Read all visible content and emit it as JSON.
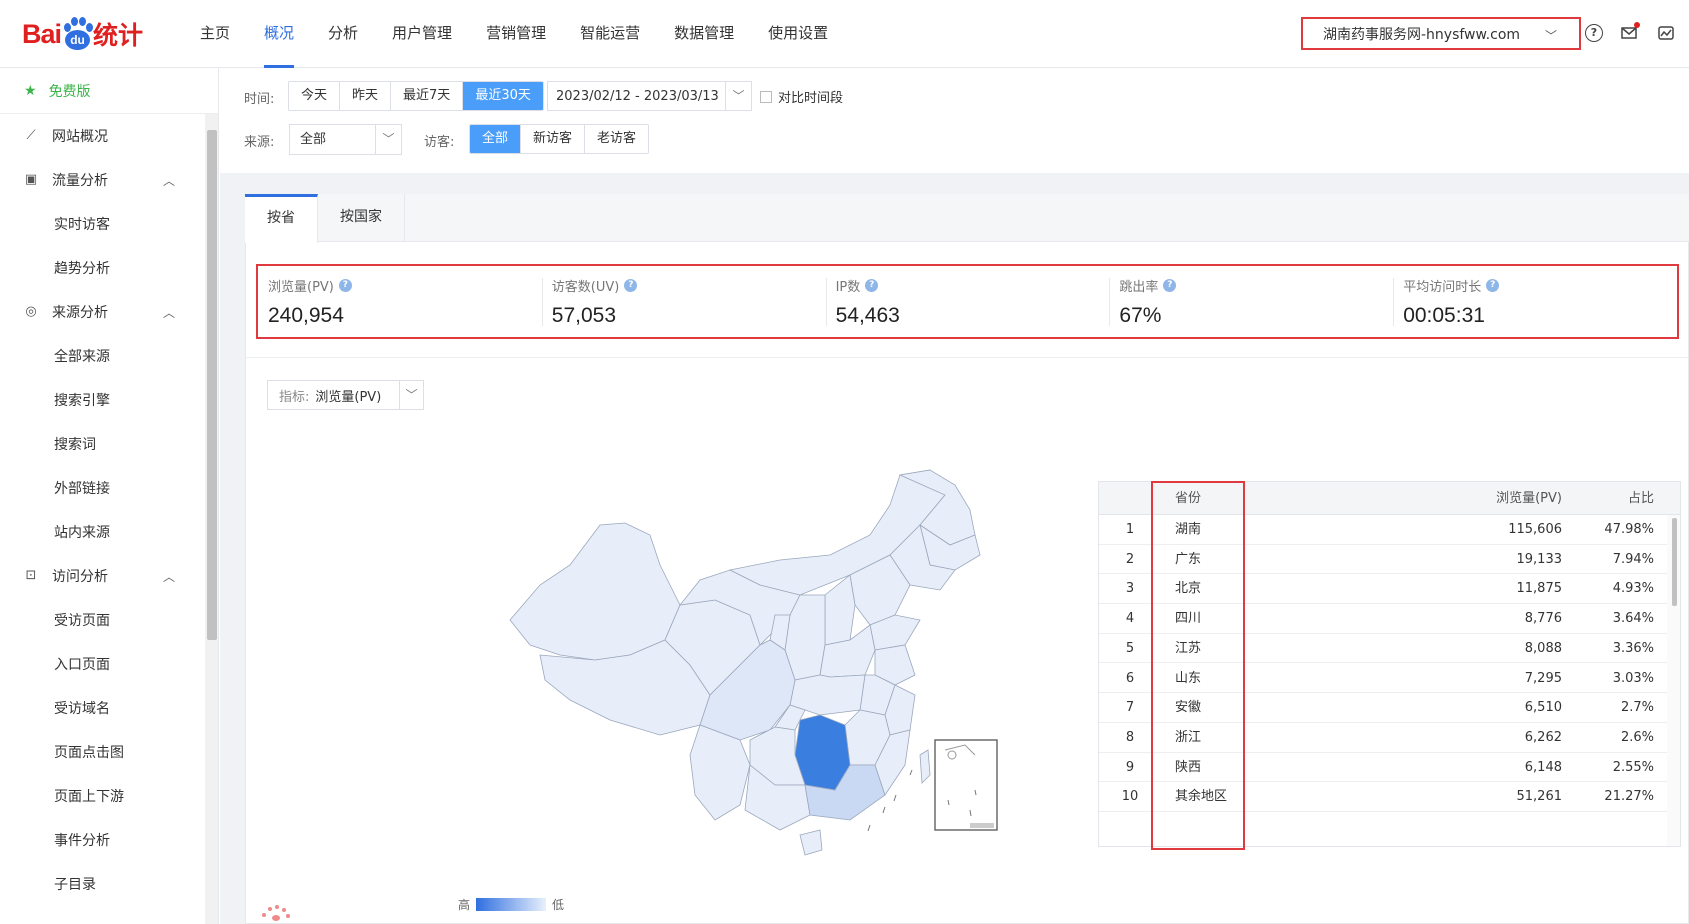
{
  "logo": {
    "bai": "Bai",
    "du": "du",
    "stat": "统计"
  },
  "nav": [
    "主页",
    "概况",
    "分析",
    "用户管理",
    "营销管理",
    "智能运营",
    "数据管理",
    "使用设置"
  ],
  "nav_active_index": 1,
  "site_selector": "湖南药事服务网-hnysfww.com",
  "top_icons": [
    "help-icon",
    "mail-icon",
    "chart-icon"
  ],
  "sidebar": {
    "edition": "免费版",
    "items": [
      {
        "label": "网站概况",
        "type": "parent",
        "icon": "line-chart-icon"
      },
      {
        "label": "流量分析",
        "type": "parent",
        "icon": "traffic-icon",
        "expanded": true
      },
      {
        "label": "实时访客",
        "type": "child"
      },
      {
        "label": "趋势分析",
        "type": "child"
      },
      {
        "label": "来源分析",
        "type": "parent",
        "icon": "signal-icon",
        "expanded": true
      },
      {
        "label": "全部来源",
        "type": "child"
      },
      {
        "label": "搜索引擎",
        "type": "child"
      },
      {
        "label": "搜索词",
        "type": "child"
      },
      {
        "label": "外部链接",
        "type": "child"
      },
      {
        "label": "站内来源",
        "type": "child"
      },
      {
        "label": "访问分析",
        "type": "parent",
        "icon": "visit-icon",
        "expanded": true
      },
      {
        "label": "受访页面",
        "type": "child"
      },
      {
        "label": "入口页面",
        "type": "child"
      },
      {
        "label": "受访域名",
        "type": "child"
      },
      {
        "label": "页面点击图",
        "type": "child"
      },
      {
        "label": "页面上下游",
        "type": "child"
      },
      {
        "label": "事件分析",
        "type": "child"
      },
      {
        "label": "子目录",
        "type": "child"
      }
    ]
  },
  "filters": {
    "time_label": "时间:",
    "time_options": [
      "今天",
      "昨天",
      "最近7天",
      "最近30天"
    ],
    "time_active": 3,
    "date_range": "2023/02/12 - 2023/03/13",
    "compare_label": "对比时间段",
    "source_label": "来源:",
    "source_value": "全部",
    "visitor_label": "访客:",
    "visitor_options": [
      "全部",
      "新访客",
      "老访客"
    ],
    "visitor_active": 0
  },
  "tabs": [
    "按省",
    "按国家"
  ],
  "tab_active": 0,
  "metrics": [
    {
      "label": "浏览量(PV)",
      "value": "240,954"
    },
    {
      "label": "访客数(UV)",
      "value": "57,053"
    },
    {
      "label": "IP数",
      "value": "54,463"
    },
    {
      "label": "跳出率",
      "value": "67%"
    },
    {
      "label": "平均访问时长",
      "value": "00:05:31"
    }
  ],
  "indicator": {
    "key": "指标:",
    "value": "浏览量(PV)"
  },
  "legend": {
    "high": "高",
    "low": "低"
  },
  "colors": {
    "accent": "#2f6fe0",
    "highlight_border": "#e0393e",
    "active_button": "#4a9df8",
    "map_max": "#3a7fe0",
    "map_min": "#e8eef9"
  },
  "table": {
    "headers": [
      "",
      "省份",
      "浏览量(PV)",
      "占比"
    ],
    "rows": [
      {
        "idx": "1",
        "province": "湖南",
        "pv": "115,606",
        "pct": "47.98%"
      },
      {
        "idx": "2",
        "province": "广东",
        "pv": "19,133",
        "pct": "7.94%"
      },
      {
        "idx": "3",
        "province": "北京",
        "pv": "11,875",
        "pct": "4.93%"
      },
      {
        "idx": "4",
        "province": "四川",
        "pv": "8,776",
        "pct": "3.64%"
      },
      {
        "idx": "5",
        "province": "江苏",
        "pv": "8,088",
        "pct": "3.36%"
      },
      {
        "idx": "6",
        "province": "山东",
        "pv": "7,295",
        "pct": "3.03%"
      },
      {
        "idx": "7",
        "province": "安徽",
        "pv": "6,510",
        "pct": "2.7%"
      },
      {
        "idx": "8",
        "province": "浙江",
        "pv": "6,262",
        "pct": "2.6%"
      },
      {
        "idx": "9",
        "province": "陕西",
        "pv": "6,148",
        "pct": "2.55%"
      },
      {
        "idx": "10",
        "province": "其余地区",
        "pv": "51,261",
        "pct": "21.27%"
      }
    ]
  }
}
